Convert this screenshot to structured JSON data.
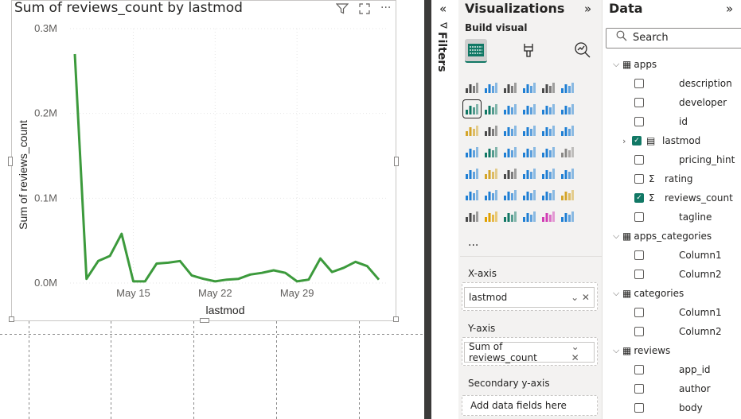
{
  "chart": {
    "title": "Sum of reviews_count by lastmod",
    "xlabel": "lastmod",
    "ylabel": "Sum of reviews_count",
    "y_ticks": [
      "0.3M",
      "0.2M",
      "0.1M",
      "0.0M"
    ],
    "x_ticks": [
      "May 15",
      "May 22",
      "May 29"
    ],
    "line_color": "#3c9a3c"
  },
  "chart_data": {
    "type": "line",
    "title": "Sum of reviews_count by lastmod",
    "xlabel": "lastmod",
    "ylabel": "Sum of reviews_count",
    "ylim": [
      0,
      300000
    ],
    "x": [
      "May 10",
      "May 11",
      "May 12",
      "May 13",
      "May 14",
      "May 15",
      "May 16",
      "May 17",
      "May 18",
      "May 19",
      "May 20",
      "May 21",
      "May 22",
      "May 23",
      "May 24",
      "May 25",
      "May 26",
      "May 27",
      "May 28",
      "May 29",
      "May 30",
      "May 31",
      "Jun 1",
      "Jun 2",
      "Jun 3",
      "Jun 4",
      "Jun 5"
    ],
    "series": [
      {
        "values": [
          270000,
          5000,
          26000,
          32000,
          58000,
          2000,
          2000,
          23000,
          24000,
          26000,
          9000,
          5000,
          2000,
          4000,
          5000,
          10000,
          12000,
          15000,
          12000,
          2000,
          4000,
          29000,
          13000,
          18000,
          25000,
          20000,
          4000
        ]
      }
    ]
  },
  "viz": {
    "title": "Visualizations",
    "build_visual": "Build visual",
    "x_axis_label": "X-axis",
    "x_axis_field": "lastmod",
    "y_axis_label": "Y-axis",
    "y_axis_field": "Sum of reviews_count",
    "secondary_label": "Secondary y-axis",
    "add_fields": "Add data fields here",
    "more": "..."
  },
  "filters": {
    "label": "Filters"
  },
  "data": {
    "title": "Data",
    "search_placeholder": "Search",
    "rows": [
      {
        "kind": "table",
        "label": "apps",
        "expanded": true
      },
      {
        "kind": "field",
        "label": "description",
        "checked": false
      },
      {
        "kind": "field",
        "label": "developer",
        "checked": false
      },
      {
        "kind": "field",
        "label": "id",
        "checked": false
      },
      {
        "kind": "hier",
        "label": "lastmod",
        "checked": true
      },
      {
        "kind": "field",
        "label": "pricing_hint",
        "checked": false
      },
      {
        "kind": "sigma",
        "label": "rating",
        "checked": false
      },
      {
        "kind": "sigma",
        "label": "reviews_count",
        "checked": true
      },
      {
        "kind": "field",
        "label": "tagline",
        "checked": false
      },
      {
        "kind": "table",
        "label": "apps_categories",
        "expanded": true
      },
      {
        "kind": "field",
        "label": "Column1",
        "checked": false
      },
      {
        "kind": "field",
        "label": "Column2",
        "checked": false
      },
      {
        "kind": "table",
        "label": "categories",
        "expanded": true
      },
      {
        "kind": "field",
        "label": "Column1",
        "checked": false
      },
      {
        "kind": "field",
        "label": "Column2",
        "checked": false
      },
      {
        "kind": "table",
        "label": "reviews",
        "expanded": true
      },
      {
        "kind": "field",
        "label": "app_id",
        "checked": false
      },
      {
        "kind": "field",
        "label": "author",
        "checked": false
      },
      {
        "kind": "field",
        "label": "body",
        "checked": false
      }
    ]
  }
}
